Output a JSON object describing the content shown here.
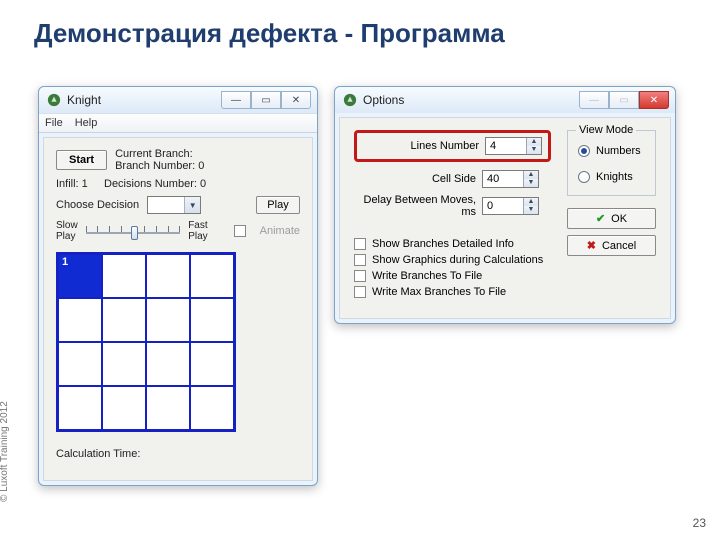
{
  "slide": {
    "title": "Демонстрация дефекта - Программа",
    "copyright": "© Luxoft Training 2012",
    "page": "23"
  },
  "knight": {
    "title": "Knight",
    "menu": {
      "file": "File",
      "help": "Help"
    },
    "start": "Start",
    "current_branch": "Current Branch:",
    "branch_number": "Branch Number: 0",
    "infill": "Infill: 1",
    "decisions": "Decisions Number: 0",
    "choose_decision": "Choose Decision",
    "play": "Play",
    "slow": "Slow\nPlay",
    "fast": "Fast\nPlay",
    "animate": "Animate",
    "grid_value": "1",
    "calc_time": "Calculation Time:"
  },
  "options": {
    "title": "Options",
    "lines_number_label": "Lines Number",
    "lines_number_value": "4",
    "cell_side_label": "Cell Side",
    "cell_side_value": "40",
    "delay_label": "Delay Between Moves, ms",
    "delay_value": "0",
    "chk1": "Show Branches Detailed Info",
    "chk2": "Show Graphics during Calculations",
    "chk3": "Write Branches To File",
    "chk4": "Write Max Branches To File",
    "view_mode": "View Mode",
    "radio_numbers": "Numbers",
    "radio_knights": "Knights",
    "ok": "OK",
    "cancel": "Cancel"
  }
}
